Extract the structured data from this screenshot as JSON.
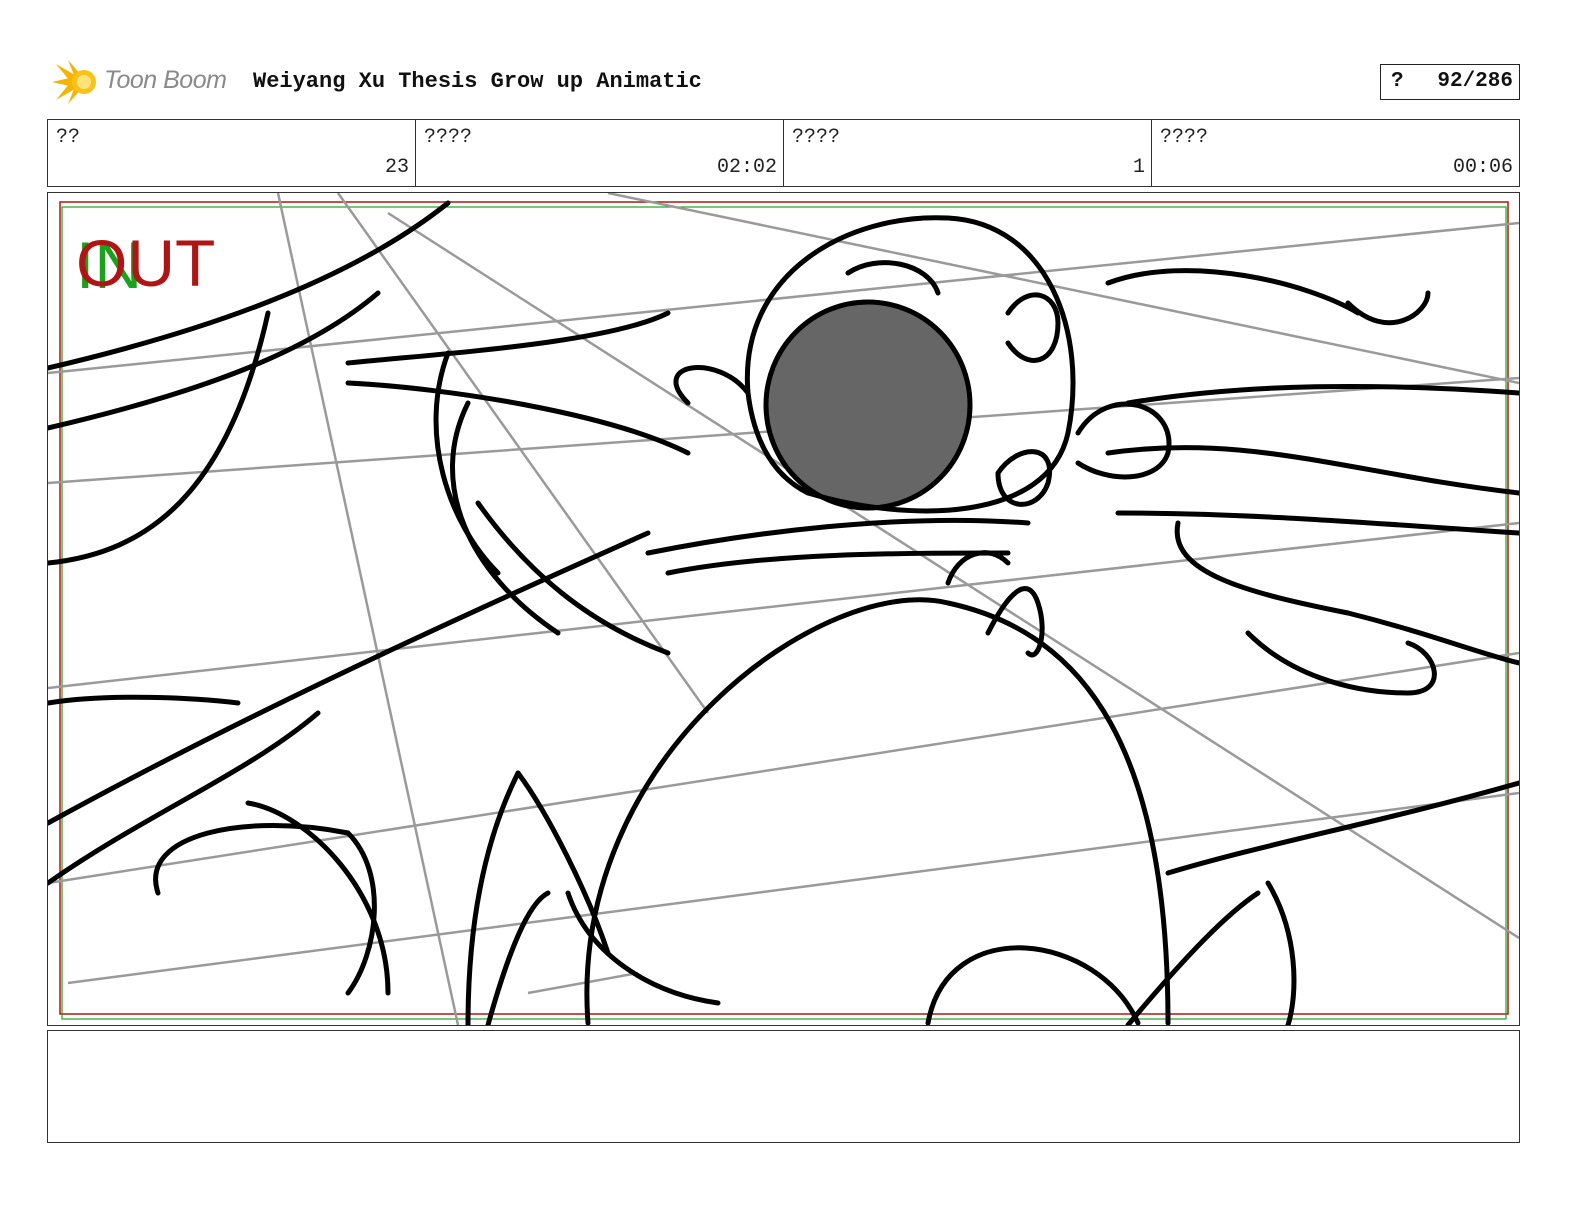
{
  "header": {
    "logo_text": "Toon Boom",
    "project_title": "Weiyang Xu Thesis Grow up Animatic",
    "page_prefix": "?",
    "page_counter": "92/286"
  },
  "info": [
    {
      "label": "??",
      "value": "23"
    },
    {
      "label": "????",
      "value": "02:02"
    },
    {
      "label": "????",
      "value": "1"
    },
    {
      "label": "????",
      "value": "00:06"
    }
  ],
  "frame": {
    "in_marker": "IN",
    "out_marker": "OUT",
    "colors": {
      "in": "#1aa31a",
      "out": "#b01515",
      "sketch": "#000000",
      "guide": "#9a9a9a",
      "fill": "#666666"
    }
  },
  "notes": {
    "text": ""
  }
}
